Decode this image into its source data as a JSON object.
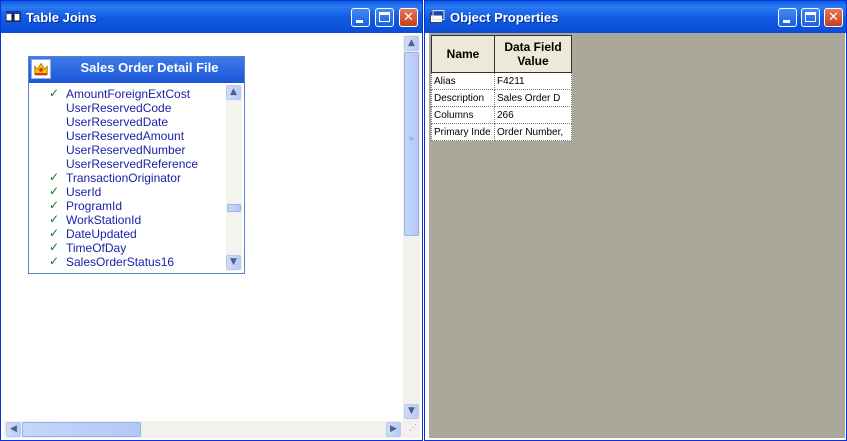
{
  "left_window": {
    "title": "Table Joins",
    "table": {
      "title": "Sales Order Detail File",
      "fields": [
        {
          "name": "AmountForeignExtCost",
          "checked": true
        },
        {
          "name": "UserReservedCode",
          "checked": false
        },
        {
          "name": "UserReservedDate",
          "checked": false
        },
        {
          "name": "UserReservedAmount",
          "checked": false
        },
        {
          "name": "UserReservedNumber",
          "checked": false
        },
        {
          "name": "UserReservedReference",
          "checked": false
        },
        {
          "name": "TransactionOriginator",
          "checked": true
        },
        {
          "name": "UserId",
          "checked": true
        },
        {
          "name": "ProgramId",
          "checked": true
        },
        {
          "name": "WorkStationId",
          "checked": true
        },
        {
          "name": "DateUpdated",
          "checked": true
        },
        {
          "name": "TimeOfDay",
          "checked": true
        },
        {
          "name": "SalesOrderStatus16",
          "checked": true
        }
      ]
    }
  },
  "right_window": {
    "title": "Object Properties",
    "columns": [
      "Name",
      "Data Field Value"
    ],
    "rows": [
      [
        "Alias",
        "F4211"
      ],
      [
        "Description",
        "Sales Order D"
      ],
      [
        "Columns",
        "266"
      ],
      [
        "Primary Inde",
        "Order Number,"
      ]
    ]
  },
  "icons": {
    "window_icon": "table-joins-icon",
    "properties_icon": "properties-icon",
    "check": "checkmark-icon",
    "crown": "crown-icon"
  },
  "glyphs": {
    "check": "✓",
    "close": "✕",
    "up": "▲",
    "down": "▼",
    "left": "◀",
    "right": "▶"
  }
}
